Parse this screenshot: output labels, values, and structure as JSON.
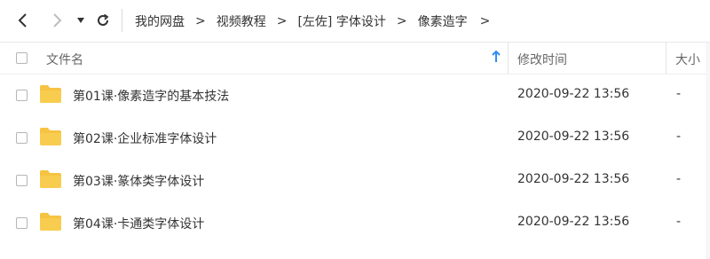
{
  "toolbar": {
    "breadcrumbs": [
      "我的网盘",
      "视频教程",
      "[左佐] 字体设计",
      "像素造字"
    ],
    "separator": ">"
  },
  "header": {
    "name_label": "文件名",
    "time_label": "修改时间",
    "size_label": "大小"
  },
  "files": [
    {
      "name": "第01课·像素造字的基本技法",
      "modified": "2020-09-22 13:56",
      "size": "-"
    },
    {
      "name": "第02课·企业标准字体设计",
      "modified": "2020-09-22 13:56",
      "size": "-"
    },
    {
      "name": "第03课·篆体类字体设计",
      "modified": "2020-09-22 13:56",
      "size": "-"
    },
    {
      "name": "第04课·卡通类字体设计",
      "modified": "2020-09-22 13:56",
      "size": "-"
    }
  ],
  "colors": {
    "folder": "#f6c342",
    "sort_arrow": "#2f8ef4"
  },
  "icons": {
    "back": "chevron-left-icon",
    "forward": "chevron-right-icon",
    "dropdown": "caret-down-icon",
    "refresh": "refresh-icon",
    "sort": "sort-arrow-up-icon",
    "folder": "folder-icon"
  }
}
